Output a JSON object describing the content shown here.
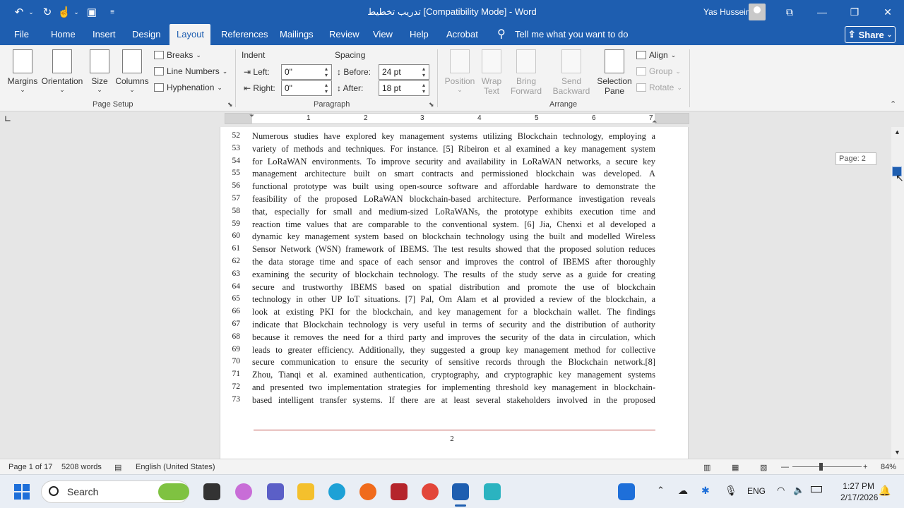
{
  "titlebar": {
    "title": "تدريب تخطيط [Compatibility Mode]  -  Word",
    "user": "Yas Hussein"
  },
  "tabs": [
    "File",
    "Home",
    "Insert",
    "Design",
    "Layout",
    "References",
    "Mailings",
    "Review",
    "View",
    "Help",
    "Acrobat"
  ],
  "active_tab": "Layout",
  "tell_me": "Tell me what you want to do",
  "share_label": "Share",
  "ribbon": {
    "page_setup": {
      "margins": "Margins",
      "orientation": "Orientation",
      "size": "Size",
      "columns": "Columns",
      "breaks": "Breaks",
      "line_numbers": "Line Numbers",
      "hyphenation": "Hyphenation",
      "group_label": "Page Setup"
    },
    "paragraph": {
      "indent_label": "Indent",
      "spacing_label": "Spacing",
      "left_label": "Left:",
      "left_value": "0\"",
      "right_label": "Right:",
      "right_value": "0\"",
      "before_label": "Before:",
      "before_value": "24 pt",
      "after_label": "After:",
      "after_value": "18 pt",
      "group_label": "Paragraph"
    },
    "arrange": {
      "position": "Position",
      "wrap_text_1": "Wrap",
      "wrap_text_2": "Text",
      "bring_forward_1": "Bring",
      "bring_forward_2": "Forward",
      "send_backward_1": "Send",
      "send_backward_2": "Backward",
      "selection_pane_1": "Selection",
      "selection_pane_2": "Pane",
      "align": "Align",
      "group": "Group",
      "rotate": "Rotate",
      "group_label": "Arrange"
    }
  },
  "ruler": {
    "numbers": [
      "1",
      "2",
      "3",
      "4",
      "5",
      "6",
      "7"
    ]
  },
  "document": {
    "lines": [
      {
        "num": "52",
        "text": "Numerous studies have explored key management systems utilizing Blockchain technology, employing a"
      },
      {
        "num": "53",
        "text": "variety of methods and techniques. For instance. [5] Ribeiron et al examined a key management system"
      },
      {
        "num": "54",
        "text": "for LoRaWAN environments. To improve security and availability in LoRaWAN networks, a secure key"
      },
      {
        "num": "55",
        "text": "management architecture built on smart contracts and permissioned blockchain was developed. A"
      },
      {
        "num": "56",
        "text": "functional prototype was built using open-source software and affordable hardware to demonstrate the"
      },
      {
        "num": "57",
        "text": "feasibility of the proposed LoRaWAN blockchain-based architecture. Performance investigation reveals"
      },
      {
        "num": "58",
        "text": "that, especially for small and medium-sized LoRaWANs, the prototype exhibits execution time and"
      },
      {
        "num": "59",
        "text": "reaction time values that are comparable to the conventional system. [6] Jia, Chenxi et al developed a"
      },
      {
        "num": "60",
        "text": "dynamic key management system based on blockchain technology using the built and modelled Wireless"
      },
      {
        "num": "61",
        "text": "Sensor Network (WSN) framework of IBEMS. The test results showed that the proposed solution reduces"
      },
      {
        "num": "62",
        "text": "the data storage time and space of each sensor and improves the control of IBEMS after thoroughly"
      },
      {
        "num": "63",
        "text": "examining the security of blockchain technology. The results of the study serve as a guide for creating"
      },
      {
        "num": "64",
        "text": "secure and trustworthy IBEMS based on spatial distribution and promote the use of blockchain"
      },
      {
        "num": "65",
        "text": "technology in other UP IoT situations. [7] Pal, Om Alam et al provided a review of the blockchain, a"
      },
      {
        "num": "66",
        "text": "look at existing PKI for the blockchain, and key management for a blockchain wallet. The findings"
      },
      {
        "num": "67",
        "text": "indicate that Blockchain technology is very useful in terms of security and the distribution of authority"
      },
      {
        "num": "68",
        "text": "because it removes the need for a third party and improves the security of the data in circulation, which"
      },
      {
        "num": "69",
        "text": "leads to greater efficiency. Additionally, they suggested a group key management method for collective"
      },
      {
        "num": "70",
        "text": "secure communication to ensure the security of sensitive records through the Blockchain network.[8]"
      },
      {
        "num": "71",
        "text": "Zhou, Tianqi et al. examined authentication, cryptography, and cryptographic key management systems"
      },
      {
        "num": "72",
        "text": "and presented two implementation strategies for implementing threshold key management in blockchain-"
      },
      {
        "num": "73",
        "text": "based intelligent transfer systems. If there are at least several stakeholders involved in the proposed"
      }
    ],
    "page_number": "2",
    "page_tooltip": "Page: 2"
  },
  "status": {
    "page": "Page 1 of 17",
    "words": "5208 words",
    "language": "English (United States)",
    "zoom": "84%"
  },
  "taskbar": {
    "search": "Search",
    "lang": "ENG",
    "time": "1:27 PM",
    "date": "2/17/2026"
  },
  "colors": {
    "brand": "#1e5eb0",
    "footer_rule": "#c0504d"
  }
}
